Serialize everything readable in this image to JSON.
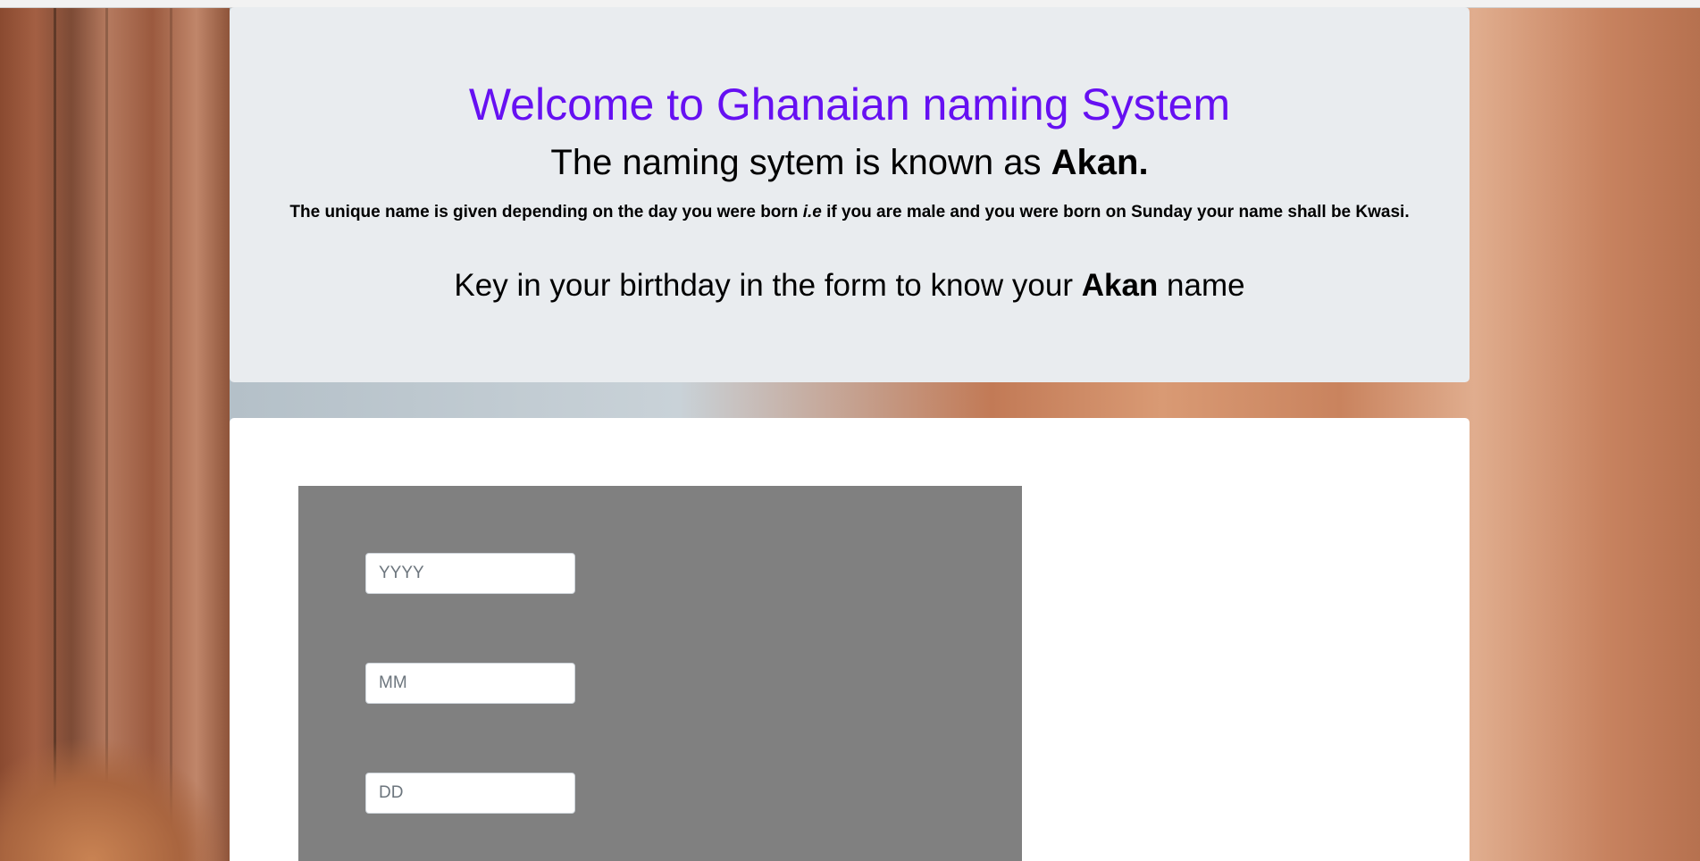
{
  "header": {
    "title": "Welcome to Ghanaian naming System",
    "subtitle_prefix": "The naming sytem is known as ",
    "subtitle_bold": "Akan.",
    "description_part1": "The unique name is given depending on the day you were born ",
    "description_italic": "i.e",
    "description_part2": " if you are male and you were born on Sunday your name shall be Kwasi.",
    "instruction_prefix": "Key in your birthday in the form to know your ",
    "instruction_bold": "Akan",
    "instruction_suffix": " name"
  },
  "form": {
    "year": {
      "placeholder": "YYYY",
      "value": ""
    },
    "month": {
      "placeholder": "MM",
      "value": ""
    },
    "day": {
      "placeholder": "DD",
      "value": ""
    }
  },
  "colors": {
    "title": "#6610f2",
    "jumbotron_bg": "#e9ecef",
    "form_panel_bg": "#808080",
    "card_bg": "#ffffff"
  },
  "background": {
    "image": "photo-of-lioness-beside-tree-trunk"
  }
}
